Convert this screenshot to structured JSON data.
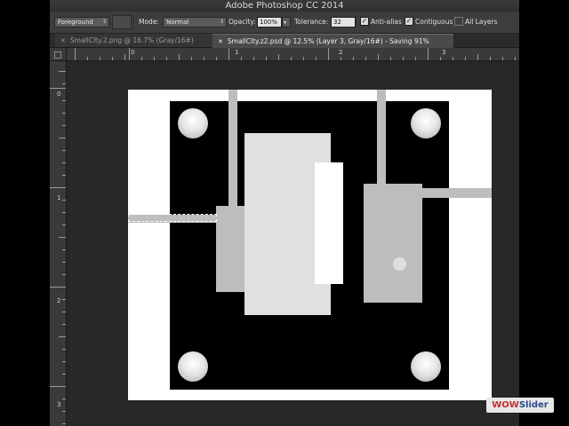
{
  "window": {
    "title": "Adobe Photoshop CC 2014"
  },
  "options_bar": {
    "preset": "Foreground",
    "mode_label": "Mode:",
    "mode_value": "Normal",
    "opacity_label": "Opacity:",
    "opacity_value": "100%",
    "tolerance_label": "Tolerance:",
    "tolerance_value": "32",
    "anti_alias_label": "Anti-alias",
    "anti_alias_checked": true,
    "contiguous_label": "Contiguous",
    "contiguous_checked": true,
    "all_layers_label": "All Layers",
    "all_layers_checked": false
  },
  "tabs": [
    {
      "label": "SmallCity.2.png @ 16.7% (Gray/16#)",
      "active": false
    },
    {
      "label": "SmallCity.z2.psd @ 12.5% (Layer 3, Gray/16#) - Saving 91%",
      "active": true
    }
  ],
  "rulers": {
    "horizontal": [
      "0",
      "1",
      "2",
      "3"
    ],
    "vertical": [
      "0",
      "1",
      "2",
      "3"
    ]
  },
  "watermark": {
    "part1": "WOW",
    "part2": "Slider"
  },
  "colors": {
    "panel": "#3d3d3d",
    "workspace": "#282828",
    "canvas_white": "#ffffff",
    "canvas_black": "#000000",
    "selection_gray": "#bdbdbd"
  }
}
